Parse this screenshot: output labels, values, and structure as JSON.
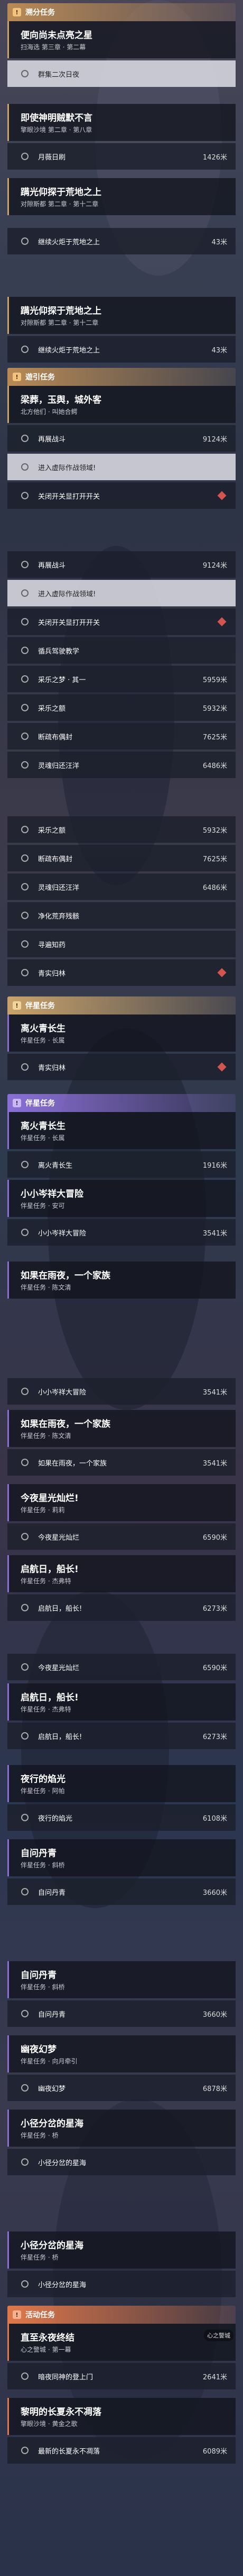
{
  "sections": {
    "sec1": {
      "title": "溯分任务",
      "icon": "!"
    },
    "sec2": {
      "title": "遊引任务",
      "icon": "!"
    },
    "sec3": {
      "title": "伴星任务",
      "icon": "!"
    },
    "sec4": {
      "title": "伴星任务",
      "icon": "!"
    },
    "sec5": {
      "title": "活动任务",
      "icon": "!"
    }
  },
  "cards": {
    "c1": {
      "title": "便向尚未点亮之星",
      "sub": "扫海选 第三章 · 第二幕"
    },
    "c2": {
      "title": "即使神明贼默不言",
      "sub": "擎眼沙境 第二章 · 第八章"
    },
    "c3": {
      "title": "蹒光仰探于荒地之上",
      "sub": "对隙斯都 第二章 · 第十二章"
    },
    "c4": {
      "title": "蹒光仰探于荒地之上",
      "sub": "对隙斯都 第二章 · 第十二章"
    },
    "c5": {
      "title": "梁葬，玉舆，城外客",
      "sub": "北方他们 · 叫她合鳄"
    },
    "c6": {
      "title": "离火青长生",
      "sub": "伴星任务 · 长属"
    },
    "c7": {
      "title": "离火青长生",
      "sub": "伴星任务 · 长属"
    },
    "c8": {
      "title": "小小岑祥大冒险",
      "sub": "伴星任务 · 安可"
    },
    "c9": {
      "title": "如果在雨夜，一个家族",
      "sub": "伴星任务 · 陈文清"
    },
    "c10": {
      "title": "如果在雨夜，一个家族",
      "sub": "伴星任务 · 陈文清"
    },
    "c11": {
      "title": "今夜星光灿烂!",
      "sub": "伴星任务 · 莉莉"
    },
    "c12": {
      "title": "启航日，船长!",
      "sub": "伴星任务 · 杰弗特"
    },
    "c13": {
      "title": "启航日，船长!",
      "sub": "伴星任务 · 杰弗特"
    },
    "c14": {
      "title": "夜行的焰光",
      "sub": "伴星任务 · 阿帕"
    },
    "c15": {
      "title": "自问丹青",
      "sub": "伴星任务 · 斜桥"
    },
    "c16": {
      "title": "自问丹青",
      "sub": "伴星任务 · 斜桥"
    },
    "c17": {
      "title": "幽夜幻梦",
      "sub": "伴星任务 · 向月牵引"
    },
    "c18": {
      "title": "小径分岔的星海",
      "sub": "伴星任务 · 桥"
    },
    "c19": {
      "title": "小径分岔的星海",
      "sub": "伴星任务 · 桥"
    },
    "c20": {
      "title": "直至永夜终结",
      "sub": "心之警城 · 第一幕"
    },
    "c21": {
      "title": "黎明的长夏永不凋落",
      "sub": "擎眼沙境 · 黄金之歌"
    }
  },
  "rows": {
    "r1": {
      "label": "群集二次日夜",
      "value": ""
    },
    "r2": {
      "label": "月薇日刷",
      "value": "1426米"
    },
    "r3": {
      "label": "继续火炬于荒地之上",
      "value": "43米"
    },
    "r4": {
      "label": "继续火炬于荒地之上",
      "value": "43米"
    },
    "r5": {
      "label": "再展战斗",
      "value": "9124米"
    },
    "r6": {
      "label": "进入虚际作战领域!",
      "value": ""
    },
    "r7": {
      "label": "关闭开关显打开开关",
      "value": ""
    },
    "r8": {
      "label": "再展战斗",
      "value": "9124米"
    },
    "r9": {
      "label": "进入虚际作战领域!",
      "value": ""
    },
    "r10": {
      "label": "关闭开关显打开开关",
      "value": ""
    },
    "r11": {
      "label": "循兵驾驶教学",
      "value": ""
    },
    "r12": {
      "label": "采乐之梦 · 其一",
      "value": "5959米"
    },
    "r13": {
      "label": "采乐之额",
      "value": "5932米"
    },
    "r14": {
      "label": "断疏布偶封",
      "value": "7625米"
    },
    "r15": {
      "label": "灵魂归还汪洋",
      "value": "6486米"
    },
    "r16": {
      "label": "采乐之额",
      "value": "5932米"
    },
    "r17": {
      "label": "断疏布偶封",
      "value": "7625米"
    },
    "r18": {
      "label": "灵魂归还汪洋",
      "value": "6486米"
    },
    "r19": {
      "label": "净化荒弃残骸",
      "value": ""
    },
    "r20": {
      "label": "寻遍知药",
      "value": ""
    },
    "r21": {
      "label": "青实归林",
      "value": ""
    },
    "r22": {
      "label": "青实归林",
      "value": ""
    },
    "r23": {
      "label": "离火青长生",
      "value": "1916米"
    },
    "r24": {
      "label": "小小岑祥大冒险",
      "value": "3541米"
    },
    "r25": {
      "label": "小小岑祥大冒险",
      "value": "3541米"
    },
    "r26": {
      "label": "如果在雨夜，一个家族",
      "value": "3541米"
    },
    "r27": {
      "label": "今夜星光灿烂",
      "value": "6590米"
    },
    "r28": {
      "label": "启航日，船长!",
      "value": "6273米"
    },
    "r29": {
      "label": "今夜星光灿烂",
      "value": "6590米"
    },
    "r30": {
      "label": "启航日，船长!",
      "value": "6273米"
    },
    "r31": {
      "label": "夜行的焰光",
      "value": "6108米"
    },
    "r32": {
      "label": "自问丹青",
      "value": "3660米"
    },
    "r33": {
      "label": "自问丹青",
      "value": "3660米"
    },
    "r34": {
      "label": "幽夜幻梦",
      "value": "6878米"
    },
    "r35": {
      "label": "小径分岔的星海",
      "value": ""
    },
    "r36": {
      "label": "小径分岔的星海",
      "value": ""
    },
    "r37": {
      "label": "暗夜同神的登上门",
      "value": "2641米"
    },
    "r38": {
      "label": "最新的长夏永不凋落",
      "value": "6089米"
    }
  },
  "watermark": "心之警城",
  "colors": {
    "gold": "#c9a36a",
    "purple": "#8b6fd6",
    "orange": "#e0784a",
    "red": "#d4554f"
  }
}
